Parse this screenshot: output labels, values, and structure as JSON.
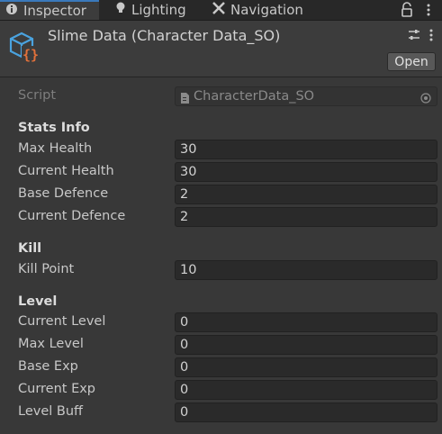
{
  "tabs": [
    {
      "label": "Inspector",
      "icon": "info-icon",
      "active": true
    },
    {
      "label": "Lighting",
      "icon": "bulb-icon",
      "active": false
    },
    {
      "label": "Navigation",
      "icon": "navigation-icon",
      "active": false
    }
  ],
  "header": {
    "title": "Slime Data (Character Data_SO)",
    "open_label": "Open",
    "asset_icon": "scriptable-object-icon"
  },
  "script": {
    "label": "Script",
    "value": "CharacterData_SO"
  },
  "sections": {
    "stats": {
      "title": "Stats Info",
      "fields": [
        {
          "label": "Max Health",
          "value": "30"
        },
        {
          "label": "Current Health",
          "value": "30"
        },
        {
          "label": "Base Defence",
          "value": "2"
        },
        {
          "label": "Current Defence",
          "value": "2"
        }
      ]
    },
    "kill": {
      "title": "Kill",
      "fields": [
        {
          "label": "Kill Point",
          "value": "10"
        }
      ]
    },
    "level": {
      "title": "Level",
      "fields": [
        {
          "label": "Current Level",
          "value": "0"
        },
        {
          "label": "Max Level",
          "value": "0"
        },
        {
          "label": "Base Exp",
          "value": "0"
        },
        {
          "label": "Current Exp",
          "value": "0"
        },
        {
          "label": "Level Buff",
          "value": "0"
        }
      ]
    }
  },
  "colors": {
    "accent": "#3a79bb",
    "background": "#383838",
    "field_bg": "#2a2a2a",
    "asset_icon_blue": "#4aa3df",
    "asset_icon_orange": "#e2713a"
  }
}
